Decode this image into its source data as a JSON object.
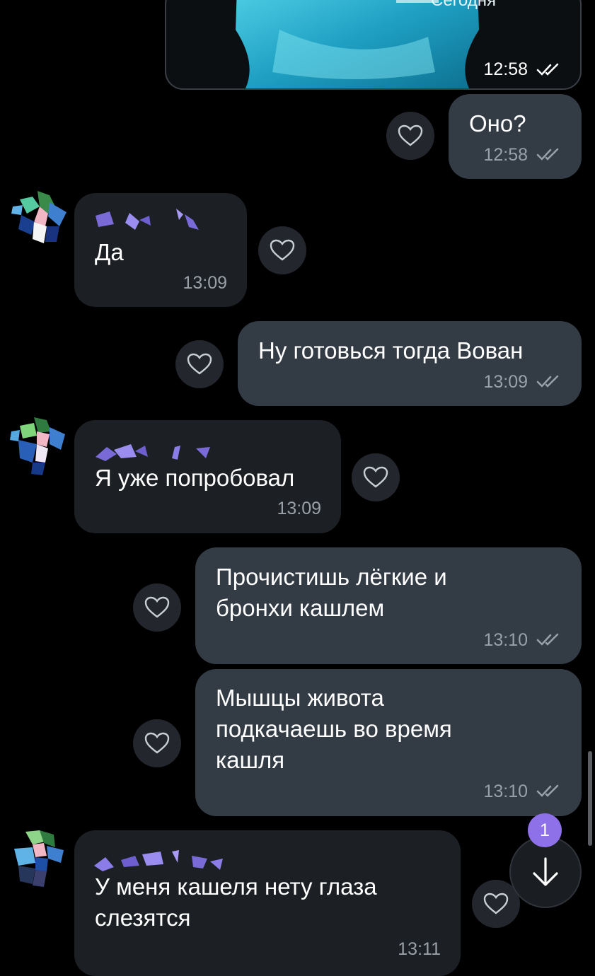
{
  "header": {
    "date_label": "Сегодня"
  },
  "media_message": {
    "time": "12:58"
  },
  "messages": [
    {
      "text": "Оно?",
      "time": "12:58"
    },
    {
      "text": "Да",
      "time": "13:09"
    },
    {
      "text": "Ну готовься тогда Вован",
      "time": "13:09"
    },
    {
      "text": "Я уже попробовал",
      "time": "13:09"
    },
    {
      "text": "Прочистишь лёгкие и\nбронхи кашлем",
      "time": "13:10"
    },
    {
      "text": "Мышцы живота\nподкачаешь во время\nкашля",
      "time": "13:10"
    },
    {
      "text": "У меня кашеля нету глаза\nслезятся",
      "time": "13:11"
    }
  ],
  "scroll_button": {
    "unread_count": "1"
  },
  "colors": {
    "background": "#000000",
    "outgoing_bubble": "#333b44",
    "incoming_bubble": "#1c1f24",
    "badge": "#8e70e8"
  }
}
